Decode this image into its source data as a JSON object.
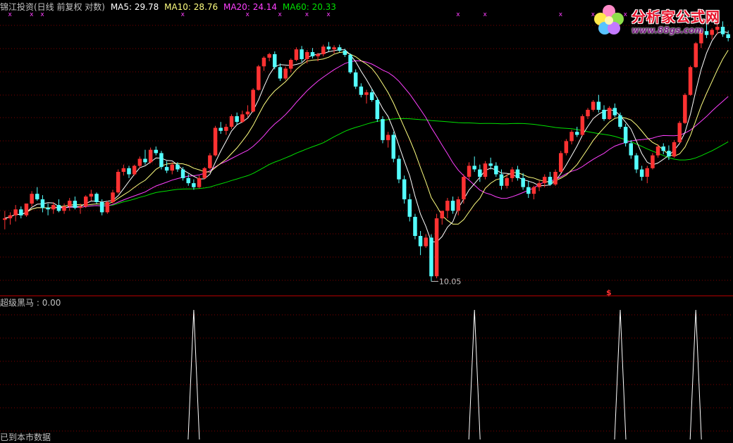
{
  "header": {
    "stock": "锦江投资(日线 前复权 对数)",
    "ma5_label": "MA5:",
    "ma5": "29.78",
    "ma10_label": "MA10:",
    "ma10": "28.76",
    "ma20_label": "MA20:",
    "ma20": "24.14",
    "ma60_label": "MA60:",
    "ma60": "20.33"
  },
  "indicator": {
    "name": "超级黑马",
    "value": "0.00"
  },
  "watermark": {
    "title": "分析家公式网",
    "url": "www.88gs.com"
  },
  "bottom_text": "已到本市数据",
  "annotations": {
    "low_label": "10.05",
    "signal_mark": "$"
  },
  "colors": {
    "up": "#ff3232",
    "down": "#54ffff",
    "ma5": "#ffffff",
    "ma10": "#ffff80",
    "ma20": "#ff40ff",
    "ma60": "#00e000",
    "grid": "#800000",
    "text": "#c0c0c0"
  },
  "chart_data": [
    {
      "type": "candlestick",
      "title": "锦江投资(日线 前复权 对数)",
      "scale": "log",
      "ylim": [
        9.8,
        36
      ],
      "grid": true,
      "candles": [
        [
          13.5,
          14.1,
          12.9,
          13.6
        ],
        [
          13.6,
          14.0,
          13.2,
          13.8
        ],
        [
          13.8,
          14.5,
          13.4,
          14.2
        ],
        [
          14.2,
          14.4,
          13.6,
          13.8
        ],
        [
          13.8,
          14.6,
          13.7,
          14.6
        ],
        [
          14.6,
          15.5,
          14.4,
          15.3
        ],
        [
          15.3,
          15.8,
          14.8,
          14.9
        ],
        [
          14.9,
          15.2,
          14.0,
          14.3
        ],
        [
          14.3,
          14.6,
          13.8,
          14.2
        ],
        [
          14.2,
          14.7,
          13.9,
          14.5
        ],
        [
          14.5,
          14.9,
          14.0,
          14.1
        ],
        [
          14.1,
          14.6,
          13.9,
          14.4
        ],
        [
          14.4,
          15.0,
          14.1,
          14.8
        ],
        [
          14.8,
          15.1,
          14.2,
          14.3
        ],
        [
          14.3,
          14.6,
          13.9,
          14.4
        ],
        [
          14.4,
          15.2,
          14.3,
          15.1
        ],
        [
          15.1,
          15.6,
          14.8,
          15.3
        ],
        [
          15.3,
          15.4,
          14.6,
          14.7
        ],
        [
          14.7,
          14.9,
          13.8,
          14.0
        ],
        [
          14.0,
          14.8,
          13.9,
          14.7
        ],
        [
          14.7,
          15.6,
          14.6,
          15.4
        ],
        [
          15.4,
          17.2,
          15.3,
          17.0
        ],
        [
          17.0,
          17.6,
          16.7,
          17.3
        ],
        [
          17.3,
          17.5,
          16.5,
          16.8
        ],
        [
          16.8,
          17.6,
          16.7,
          17.5
        ],
        [
          17.5,
          18.3,
          17.3,
          18.1
        ],
        [
          18.1,
          18.9,
          17.6,
          17.8
        ],
        [
          17.8,
          19.1,
          17.7,
          18.9
        ],
        [
          18.9,
          19.2,
          18.4,
          18.6
        ],
        [
          18.6,
          18.8,
          17.2,
          17.4
        ],
        [
          17.4,
          17.9,
          16.9,
          17.1
        ],
        [
          17.1,
          17.8,
          16.8,
          17.6
        ],
        [
          17.6,
          17.8,
          17.0,
          17.2
        ],
        [
          17.2,
          17.4,
          16.3,
          16.5
        ],
        [
          16.5,
          16.8,
          15.9,
          16.1
        ],
        [
          16.1,
          16.4,
          15.6,
          15.8
        ],
        [
          15.8,
          16.7,
          15.7,
          16.5
        ],
        [
          16.5,
          17.4,
          16.4,
          17.3
        ],
        [
          17.3,
          18.6,
          17.2,
          18.4
        ],
        [
          18.4,
          21.2,
          18.3,
          21.0
        ],
        [
          21.0,
          21.6,
          20.4,
          20.7
        ],
        [
          20.7,
          21.4,
          20.3,
          21.1
        ],
        [
          21.1,
          22.4,
          20.9,
          22.2
        ],
        [
          22.2,
          22.6,
          21.3,
          21.6
        ],
        [
          21.6,
          22.8,
          21.5,
          22.4
        ],
        [
          22.4,
          23.4,
          22.1,
          22.7
        ],
        [
          22.7,
          25.4,
          22.6,
          25.2
        ],
        [
          25.2,
          28.4,
          25.1,
          28.2
        ],
        [
          28.2,
          29.6,
          27.6,
          29.4
        ],
        [
          29.4,
          30.1,
          28.9,
          29.9
        ],
        [
          29.9,
          30.3,
          27.8,
          28.1
        ],
        [
          28.1,
          28.6,
          26.3,
          26.6
        ],
        [
          26.6,
          28.2,
          26.4,
          27.9
        ],
        [
          27.9,
          29.3,
          27.4,
          29.1
        ],
        [
          29.1,
          30.9,
          28.9,
          30.6
        ],
        [
          30.6,
          31.1,
          28.8,
          29.2
        ],
        [
          29.2,
          30.5,
          28.6,
          30.2
        ],
        [
          30.2,
          30.8,
          29.3,
          29.6
        ],
        [
          29.6,
          30.1,
          28.9,
          29.9
        ],
        [
          29.9,
          31.3,
          29.6,
          31.0
        ],
        [
          31.0,
          31.7,
          30.3,
          30.6
        ],
        [
          30.6,
          31.2,
          30.0,
          30.9
        ],
        [
          30.9,
          31.3,
          30.2,
          30.4
        ],
        [
          30.4,
          30.7,
          29.5,
          29.8
        ],
        [
          29.8,
          30.0,
          27.2,
          27.4
        ],
        [
          27.4,
          27.8,
          25.3,
          25.6
        ],
        [
          25.6,
          26.0,
          24.3,
          24.6
        ],
        [
          24.6,
          25.2,
          23.6,
          24.9
        ],
        [
          24.9,
          25.3,
          23.8,
          24.0
        ],
        [
          24.0,
          24.3,
          21.6,
          21.9
        ],
        [
          21.9,
          22.2,
          19.5,
          19.8
        ],
        [
          19.8,
          20.6,
          19.1,
          20.3
        ],
        [
          20.3,
          20.6,
          17.8,
          18.1
        ],
        [
          18.1,
          18.4,
          16.1,
          16.4
        ],
        [
          16.4,
          16.7,
          14.6,
          14.9
        ],
        [
          14.9,
          15.3,
          13.4,
          13.7
        ],
        [
          13.7,
          13.9,
          12.3,
          12.5
        ],
        [
          12.5,
          12.8,
          11.4,
          11.9
        ],
        [
          11.9,
          12.6,
          11.8,
          12.4
        ],
        [
          12.4,
          12.6,
          10.05,
          10.3
        ],
        [
          10.3,
          13.9,
          10.2,
          13.6
        ],
        [
          13.6,
          14.1,
          13.2,
          14.1
        ],
        [
          14.1,
          15.0,
          13.6,
          14.8
        ],
        [
          14.8,
          15.1,
          13.9,
          14.1
        ],
        [
          14.1,
          15.1,
          13.8,
          14.9
        ],
        [
          14.9,
          16.8,
          14.6,
          16.6
        ],
        [
          16.6,
          17.8,
          16.4,
          17.5
        ],
        [
          17.5,
          18.3,
          17.0,
          17.2
        ],
        [
          17.2,
          17.6,
          16.2,
          16.6
        ],
        [
          16.6,
          17.9,
          16.4,
          17.7
        ],
        [
          17.7,
          18.2,
          17.2,
          17.5
        ],
        [
          17.5,
          17.8,
          16.6,
          16.8
        ],
        [
          16.8,
          17.2,
          15.6,
          15.9
        ],
        [
          15.9,
          16.8,
          15.7,
          16.5
        ],
        [
          16.5,
          17.4,
          16.2,
          17.2
        ],
        [
          17.2,
          17.5,
          16.3,
          16.5
        ],
        [
          16.5,
          16.9,
          15.6,
          15.8
        ],
        [
          15.8,
          16.3,
          15.0,
          15.3
        ],
        [
          15.3,
          15.9,
          14.9,
          15.8
        ],
        [
          15.8,
          16.3,
          15.5,
          16.1
        ],
        [
          16.1,
          16.8,
          15.8,
          16.6
        ],
        [
          16.6,
          17.0,
          15.9,
          16.0
        ],
        [
          16.0,
          17.2,
          15.9,
          17.0
        ],
        [
          17.0,
          18.8,
          16.9,
          18.6
        ],
        [
          18.6,
          19.9,
          18.4,
          19.7
        ],
        [
          19.7,
          20.8,
          19.4,
          20.6
        ],
        [
          20.6,
          21.1,
          20.1,
          20.3
        ],
        [
          20.3,
          22.4,
          20.2,
          22.2
        ],
        [
          22.2,
          23.1,
          21.9,
          22.9
        ],
        [
          22.9,
          24.0,
          22.7,
          23.8
        ],
        [
          23.8,
          24.6,
          22.6,
          22.9
        ],
        [
          22.9,
          23.4,
          21.7,
          21.9
        ],
        [
          21.9,
          23.3,
          21.8,
          23.1
        ],
        [
          23.1,
          23.6,
          22.1,
          22.3
        ],
        [
          22.3,
          22.6,
          20.9,
          21.1
        ],
        [
          21.1,
          21.4,
          19.2,
          19.5
        ],
        [
          19.5,
          19.8,
          18.1,
          18.4
        ],
        [
          18.4,
          18.6,
          16.9,
          17.2
        ],
        [
          17.2,
          17.5,
          16.3,
          16.6
        ],
        [
          16.6,
          17.5,
          16.1,
          17.3
        ],
        [
          17.3,
          18.6,
          17.2,
          18.4
        ],
        [
          18.4,
          19.4,
          18.2,
          19.2
        ],
        [
          19.2,
          19.5,
          18.5,
          18.8
        ],
        [
          18.8,
          19.3,
          18.0,
          18.3
        ],
        [
          18.3,
          19.8,
          18.2,
          19.6
        ],
        [
          19.6,
          21.7,
          19.5,
          21.5
        ],
        [
          21.5,
          24.8,
          21.4,
          24.6
        ],
        [
          24.6,
          28.3,
          24.5,
          28.1
        ],
        [
          28.1,
          31.7,
          28.0,
          31.5
        ],
        [
          31.5,
          33.9,
          30.8,
          33.4
        ],
        [
          33.4,
          34.8,
          32.3,
          32.8
        ],
        [
          32.8,
          33.9,
          32.1,
          33.6
        ],
        [
          33.6,
          34.6,
          32.9,
          34.1
        ],
        [
          34.1,
          35.0,
          32.5,
          32.9
        ],
        [
          32.9,
          33.5,
          31.8,
          32.3
        ]
      ]
    },
    {
      "type": "line",
      "title": "超级黑马",
      "signals": [
        35,
        87,
        114,
        128
      ],
      "value": 0.0
    }
  ]
}
